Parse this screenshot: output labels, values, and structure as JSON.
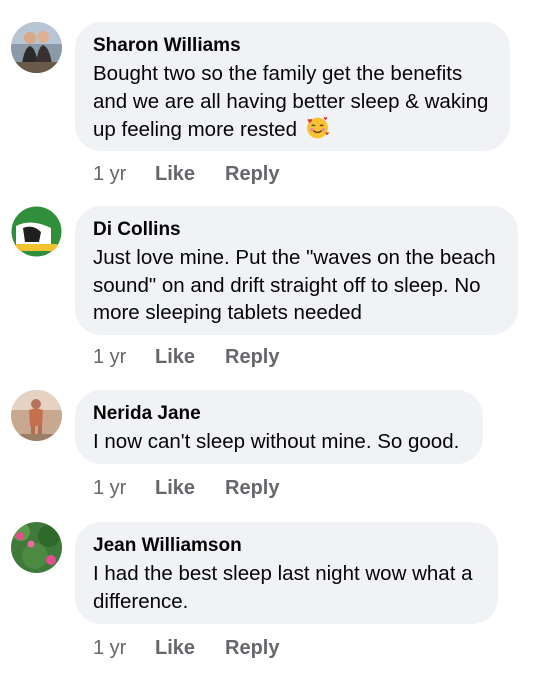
{
  "comments": [
    {
      "author": "Sharon Williams",
      "text": "Bought two so the family get the benefits and we are all having better sleep & waking up feeling more rested",
      "emoji": "smiling-face-with-hearts",
      "time": "1 yr",
      "like_label": "Like",
      "reply_label": "Reply"
    },
    {
      "author": "Di Collins",
      "text": "Just love mine. Put the \"waves on the beach sound\" on and drift straight off to sleep. No more sleeping tablets needed",
      "time": "1 yr",
      "like_label": "Like",
      "reply_label": "Reply"
    },
    {
      "author": "Nerida Jane",
      "text": "I now can't sleep without mine. So good.",
      "time": "1 yr",
      "like_label": "Like",
      "reply_label": "Reply"
    },
    {
      "author": "Jean Williamson",
      "text": "I had the best sleep last night wow what a difference.",
      "time": "1 yr",
      "like_label": "Like",
      "reply_label": "Reply"
    }
  ],
  "colors": {
    "bubble": "#f0f2f5",
    "text": "#050505",
    "meta": "#65676b"
  }
}
